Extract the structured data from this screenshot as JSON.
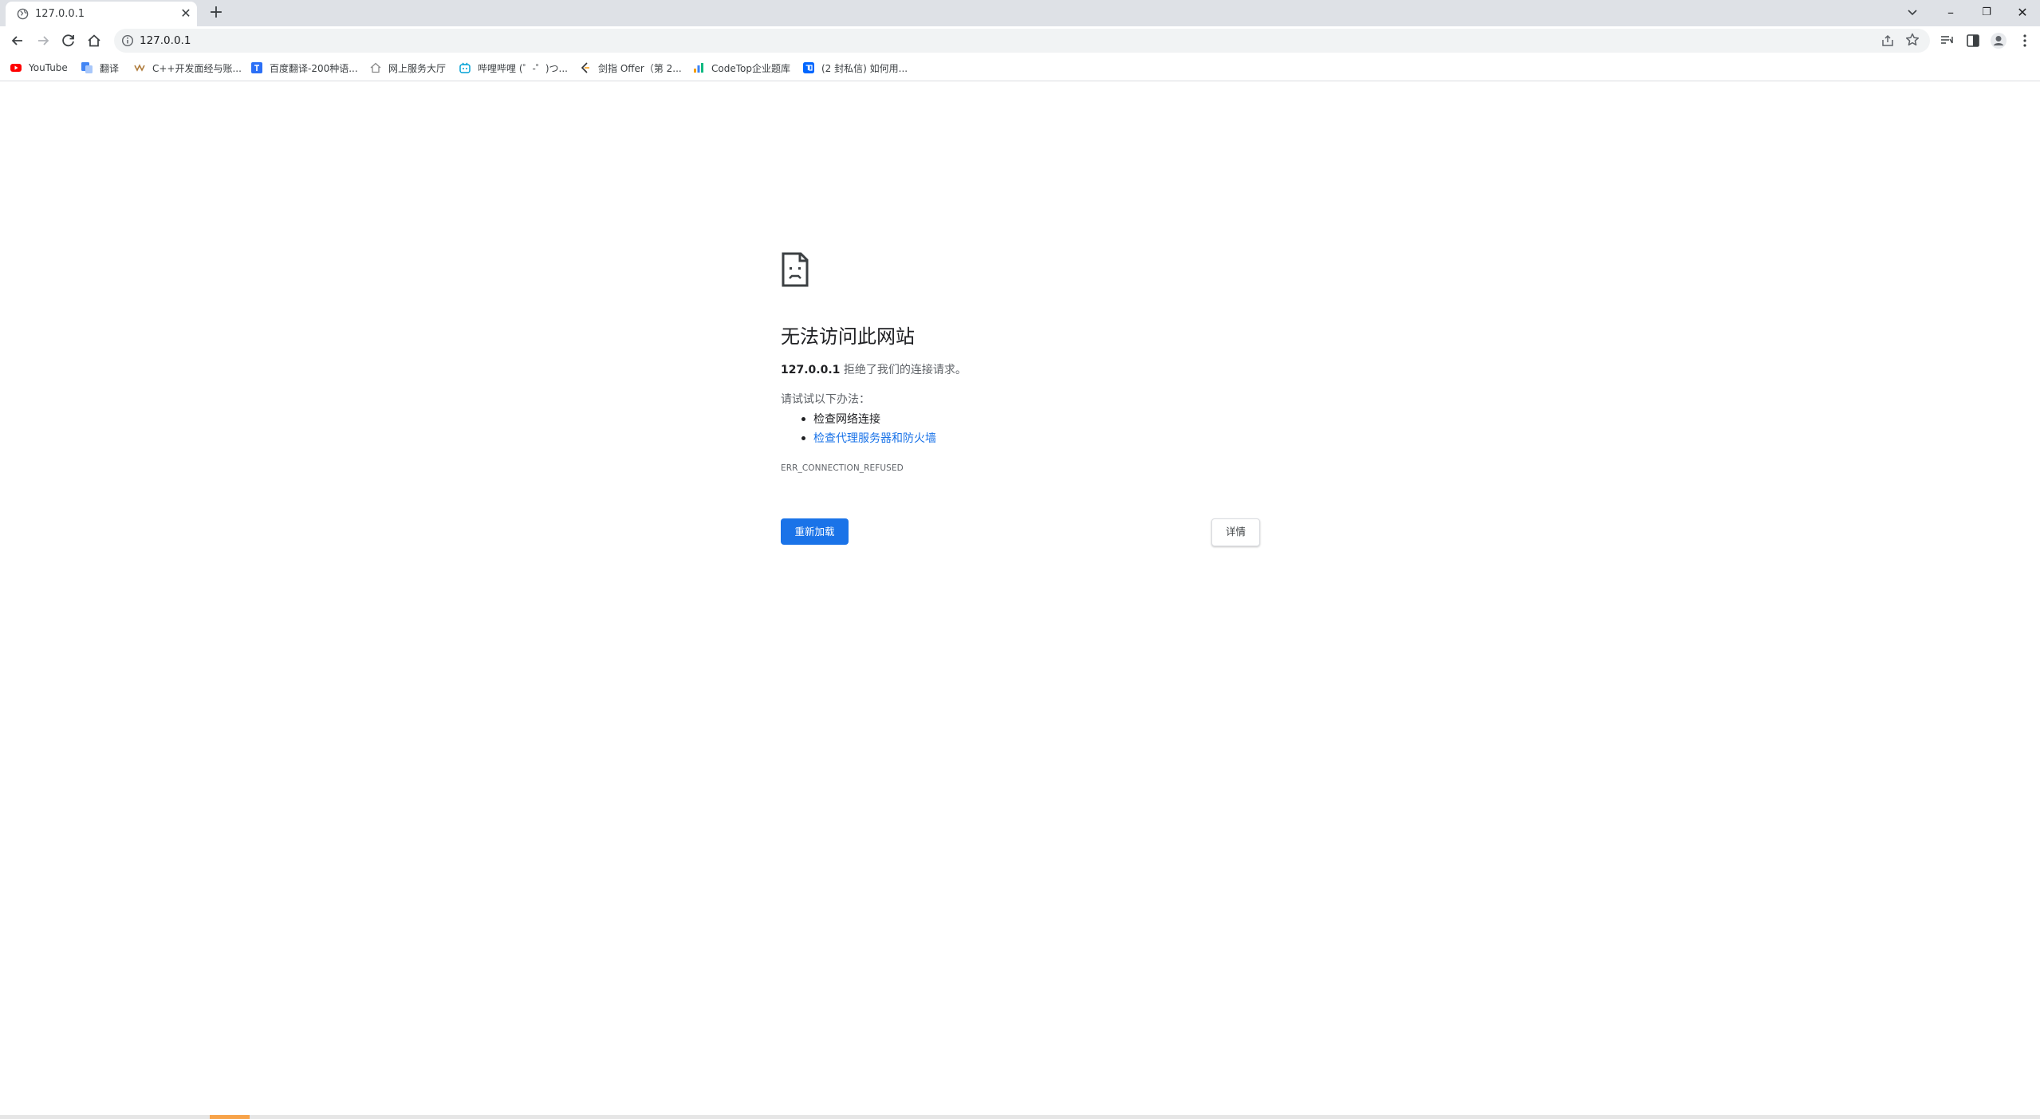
{
  "tab": {
    "title": "127.0.0.1",
    "close": "✕"
  },
  "newtab": "+",
  "window": {
    "minimize": "–",
    "restore": "❐",
    "close": "✕"
  },
  "omnibox": {
    "url": "127.0.0.1"
  },
  "bookmarks": [
    {
      "label": "YouTube",
      "icon": "youtube-icon",
      "color": "#ff0000"
    },
    {
      "label": "翻译",
      "icon": "translate-icon",
      "color": "#4285f4"
    },
    {
      "label": "C++开发面经与账...",
      "icon": "site-icon",
      "color": "#b07c3c"
    },
    {
      "label": "百度翻译-200种语...",
      "icon": "baidu-translate-icon",
      "color": "#2b6ff6"
    },
    {
      "label": "网上服务大厅",
      "icon": "house-icon",
      "color": "#8a8a8a"
    },
    {
      "label": "哔哩哔哩 (゜-゜)つ...",
      "icon": "bilibili-icon",
      "color": "#00a1d6"
    },
    {
      "label": "剑指 Offer（第 2...",
      "icon": "leetcode-icon",
      "color": "#f89f1b"
    },
    {
      "label": "CodeTop企业题库",
      "icon": "codetop-icon",
      "color": "#3b82f6"
    },
    {
      "label": "(2 封私信) 如何用...",
      "icon": "zhihu-icon",
      "color": "#0066ff"
    }
  ],
  "error": {
    "title": "无法访问此网站",
    "host": "127.0.0.1",
    "desc_rest": " 拒绝了我们的连接请求。",
    "try": "请试试以下办法：",
    "suggestions": [
      "检查网络连接",
      "检查代理服务器和防火墙"
    ],
    "code": "ERR_CONNECTION_REFUSED",
    "reload": "重新加载",
    "details": "详情"
  },
  "colors": {
    "accent": "#1a73e8",
    "tabstrip": "#dee1e6",
    "omnibox": "#f1f3f4"
  }
}
